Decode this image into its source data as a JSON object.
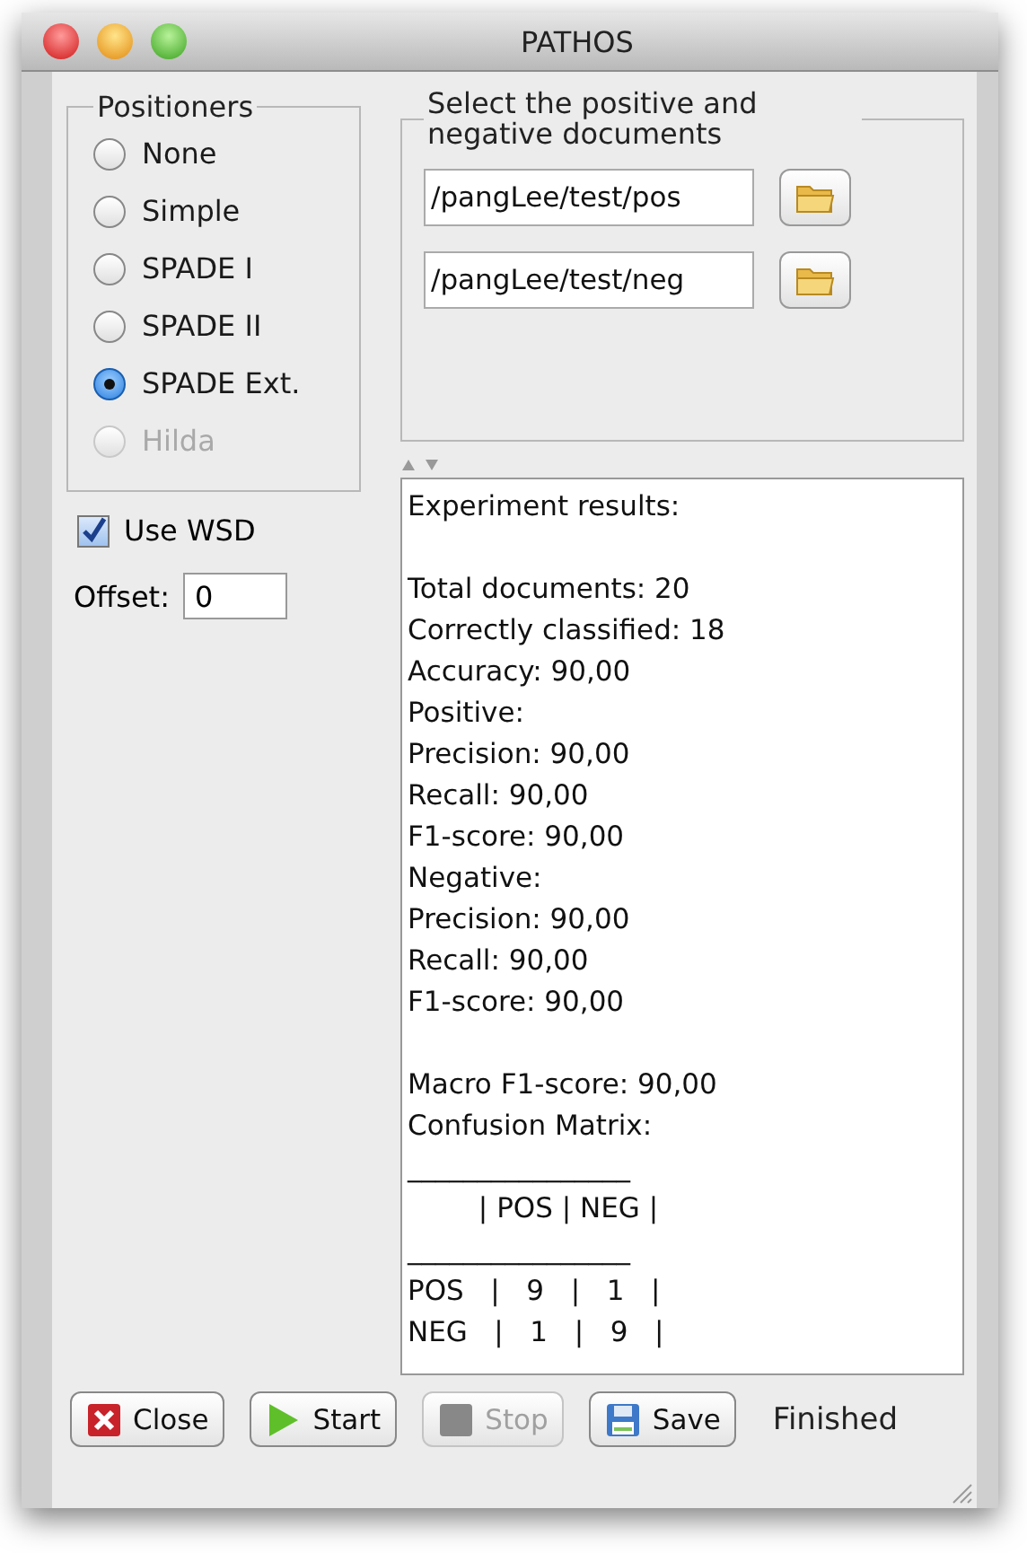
{
  "window": {
    "title": "PATHOS"
  },
  "positioners": {
    "title": "Positioners",
    "options": [
      {
        "label": "None",
        "selected": false,
        "disabled": false
      },
      {
        "label": "Simple",
        "selected": false,
        "disabled": false
      },
      {
        "label": "SPADE I",
        "selected": false,
        "disabled": false
      },
      {
        "label": "SPADE II",
        "selected": false,
        "disabled": false
      },
      {
        "label": "SPADE Ext.",
        "selected": true,
        "disabled": false
      },
      {
        "label": "Hilda",
        "selected": false,
        "disabled": true
      }
    ]
  },
  "use_wsd": {
    "label": "Use WSD",
    "checked": true
  },
  "offset": {
    "label": "Offset:",
    "value": "0"
  },
  "documents": {
    "title": "Select the positive and negative documents",
    "paths": [
      {
        "value": "/pangLee/test/pos"
      },
      {
        "value": "/pangLee/test/neg"
      }
    ]
  },
  "results": {
    "paragraphs": [
      [
        "Experiment results:"
      ],
      [
        "Total documents: 20",
        "Correctly classified: 18",
        "Accuracy: 90,00",
        "Positive:",
        "Precision: 90,00",
        "Recall: 90,00",
        "F1-score: 90,00",
        "Negative:",
        "Precision: 90,00",
        "Recall: 90,00",
        "F1-score: 90,00"
      ],
      [
        "Macro F1-score: 90,00",
        "Confusion Matrix:",
        "________________",
        "        | POS | NEG |",
        "________________",
        "POS   |   9   |   1   |",
        "NEG   |   1   |   9   |"
      ]
    ]
  },
  "buttons": [
    {
      "kind": "close",
      "label": "Close",
      "disabled": false
    },
    {
      "kind": "start",
      "label": "Start",
      "disabled": false
    },
    {
      "kind": "stop",
      "label": "Stop",
      "disabled": true
    },
    {
      "kind": "save",
      "label": "Save",
      "disabled": false
    }
  ],
  "status": "Finished"
}
